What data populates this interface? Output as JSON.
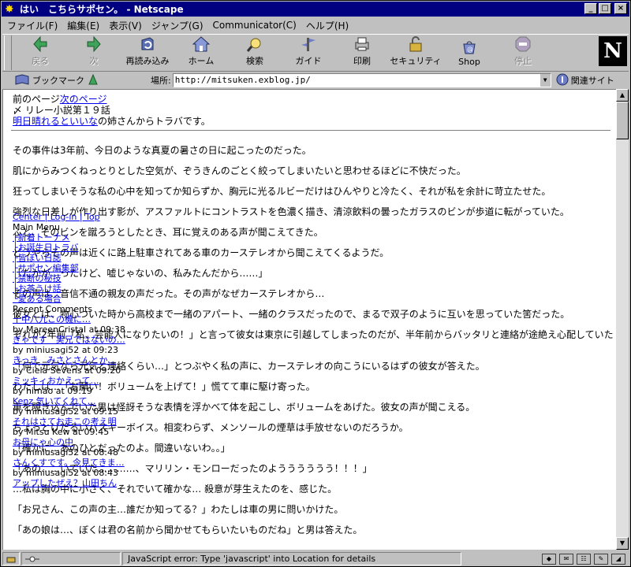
{
  "window": {
    "title": "はい　こちらサポセン。 - Netscape"
  },
  "menu": [
    "ファイル(F)",
    "編集(E)",
    "表示(V)",
    "ジャンプ(G)",
    "Communicator(C)",
    "ヘルプ(H)"
  ],
  "toolbar": [
    {
      "label": "戻る",
      "icon": "back-arrow-icon",
      "disabled": true
    },
    {
      "label": "次",
      "icon": "forward-arrow-icon",
      "disabled": true
    },
    {
      "label": "再読み込み",
      "icon": "reload-icon",
      "disabled": false
    },
    {
      "label": "ホーム",
      "icon": "home-icon",
      "disabled": false
    },
    {
      "label": "検索",
      "icon": "search-icon",
      "disabled": false
    },
    {
      "label": "ガイド",
      "icon": "guide-icon",
      "disabled": false
    },
    {
      "label": "印刷",
      "icon": "print-icon",
      "disabled": false
    },
    {
      "label": "セキュリティ",
      "icon": "lock-icon",
      "disabled": false
    },
    {
      "label": "Shop",
      "icon": "shop-icon",
      "disabled": false
    },
    {
      "label": "停止",
      "icon": "stop-icon",
      "disabled": true
    }
  ],
  "location": {
    "bookmark_label": "ブックマーク",
    "label": "場所:",
    "url": "http://mitsuken.exblog.jp/",
    "related_label": "関連サイト"
  },
  "header": {
    "prev_text": "前のページ",
    "next_link": "次のページ",
    "relay_title": "〆 リレー小説第１９話",
    "trackback_link": "明日晴れるといいな",
    "trackback_rest": "の姉さんからトラバです。"
  },
  "story": [
    "その事件は3年前、今日のような真夏の暑さの日に起こったのだった。",
    "肌にからみつくねっとりとした空気が、ぞうきんのごとく絞ってしまいたいと思わせるほどに不快だった。",
    "狂ってしまいそうな私の心中を知ってか知らずか、胸元に光るルビーだけはひんやりと冷たく、それが私を余計に苛立たせた。",
    "強烈な日差しが作り出す影が、アスファルトにコントラストを色濃く描き、清涼飲料の曇ったガラスのビンが歩道に転がっていた。",
    "ふと、そのビンを蹴ろうとしたとき、耳に覚えのある声が聞こえてきた。",
    "どうやらその声は近くに路上駐車されてある車のカーステレオから聞こえてくるようだ。",
    "「たかが…ったけど、嘘じゃないの、私みたんだから……」",
    "その声は…音信不通の親友の声だった。その声がなぜカーステレオから…",
    "彼女とは、物心ついた時から高校まで一緒のアパート、一緒のクラスだったので、まるで双子のように互いを思っていた筈だった。",
    "それが2年前「私、芸能人になりたいの！」と言って彼女は東京に引越してしまったのだが、半年前からバッタリと連絡が途絶え心配していた",
    "「何で元気なら元気と連絡くらい…」とつぶやく私の声に、カーステレオの向こうにいるはずの彼女が答えた。",
    "わたしは…「お願い！ボリュームを上げて！」慌てて車に駆け寄った。",
    "車を覗き込んでいた男は怪訝そうな表情を浮かべて体を起こし、ボリュームをあげた。彼女の声が聞こえる。",
    "ちょっとけだるいハスキーボイス。相変わらず、メンソールの煙草は手放せないのだろうか。",
    "「確かに…あのひとだったのよ。間違いないわ。。」",
    "「あの……いていた…………、マリリン・モンローだったのようううううう！！！」",
    "…私は胸の中に小さく、それでいて確かな… 殺意が芽生えたのを、感じた。",
    "「お兄さん、この声の主…誰だか知ってる？」わたしは車の男に問いかけた。",
    "「あの娘は…、ぼくは君の名前から聞かせてもらいたいものだね」と男は答えた。"
  ],
  "sidebar_overlay": [
    {
      "text": "Center | Log-in | Top",
      "link": true
    },
    {
      "text": "Main Menu",
      "link": false
    },
    {
      "text": "├新着トーナメ",
      "link": true
    },
    {
      "text": "├お誕生日トラバ",
      "link": true
    },
    {
      "text": "├皆ぽい日誌",
      "link": true
    },
    {
      "text": "├サポセン編集部",
      "link": true
    },
    {
      "text": "├禁断の秘技",
      "link": true
    },
    {
      "text": "├お茶うけ話",
      "link": true
    },
    {
      "text": "└愛ある場合",
      "link": true
    },
    {
      "text": "Recent Comments",
      "link": false
    },
    {
      "text": "十中八九この機に…",
      "link": true
    },
    {
      "text": "by MareenCristal at 09:38",
      "link": false
    },
    {
      "text": "ぎゃです　実兄ではないの…",
      "link": true
    },
    {
      "text": "by miniusagi52 at 09:23",
      "link": false
    },
    {
      "text": "きっき　みさとさんとか…",
      "link": true
    },
    {
      "text": "by Ciela Sevens at 09:20",
      "link": false
    },
    {
      "text": "ミッキィおかえって…",
      "link": true
    },
    {
      "text": "by himao at 09:19",
      "link": false
    },
    {
      "text": "Kenz 気いてくれて…",
      "link": true
    },
    {
      "text": "by miniusagi52 at 09:15",
      "link": false
    },
    {
      "text": "それはさてお走この考え明",
      "link": true
    },
    {
      "text": "by Mitsu Kew at 09:45",
      "link": false
    },
    {
      "text": "お母にゃ心の中",
      "link": true
    },
    {
      "text": "by miniusagi52 at 08:48",
      "link": false
    },
    {
      "text": "さんくすです。今見てきま…",
      "link": true
    },
    {
      "text": "by miniusagi52 at 08:43",
      "link": false
    },
    {
      "text": "アップしたぜえ？山田ちん",
      "link": true
    }
  ],
  "status": {
    "text": "JavaScript error: Type 'javascript' into Location for details"
  }
}
